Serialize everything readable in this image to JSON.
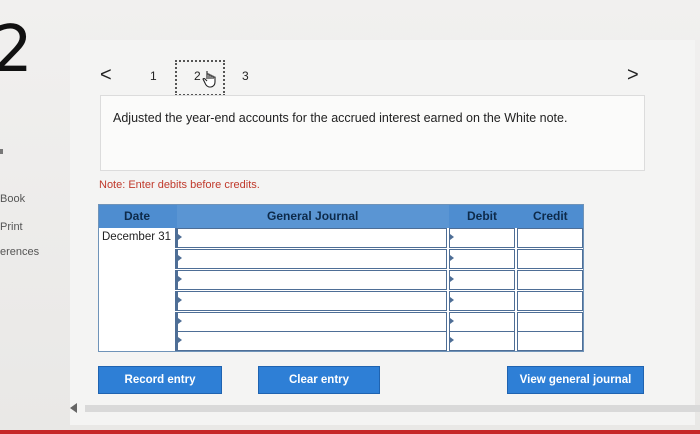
{
  "left_rail": {
    "big_digit": "2",
    "links": [
      "Book",
      "Print",
      "erences"
    ]
  },
  "pagination": {
    "prev_label": "<",
    "next_label": ">",
    "pages": [
      "1",
      "2",
      "3"
    ],
    "current_page": "2"
  },
  "question": {
    "text": "Adjusted the year-end accounts for the accrued interest earned on the White note."
  },
  "note": "Note: Enter debits before credits.",
  "journal": {
    "headers": {
      "date": "Date",
      "account": "General Journal",
      "debit": "Debit",
      "credit": "Credit"
    },
    "rows": [
      {
        "date": "December 31",
        "account": "",
        "debit": "",
        "credit": ""
      },
      {
        "date": "",
        "account": "",
        "debit": "",
        "credit": ""
      },
      {
        "date": "",
        "account": "",
        "debit": "",
        "credit": ""
      },
      {
        "date": "",
        "account": "",
        "debit": "",
        "credit": ""
      },
      {
        "date": "",
        "account": "",
        "debit": "",
        "credit": ""
      },
      {
        "date": "",
        "account": "",
        "debit": "",
        "credit": ""
      }
    ]
  },
  "buttons": {
    "record": "Record entry",
    "clear": "Clear entry",
    "view": "View general journal"
  },
  "colors": {
    "accent": "#2e7fd6",
    "header": "#4e8dd0",
    "note": "#c0392b"
  }
}
